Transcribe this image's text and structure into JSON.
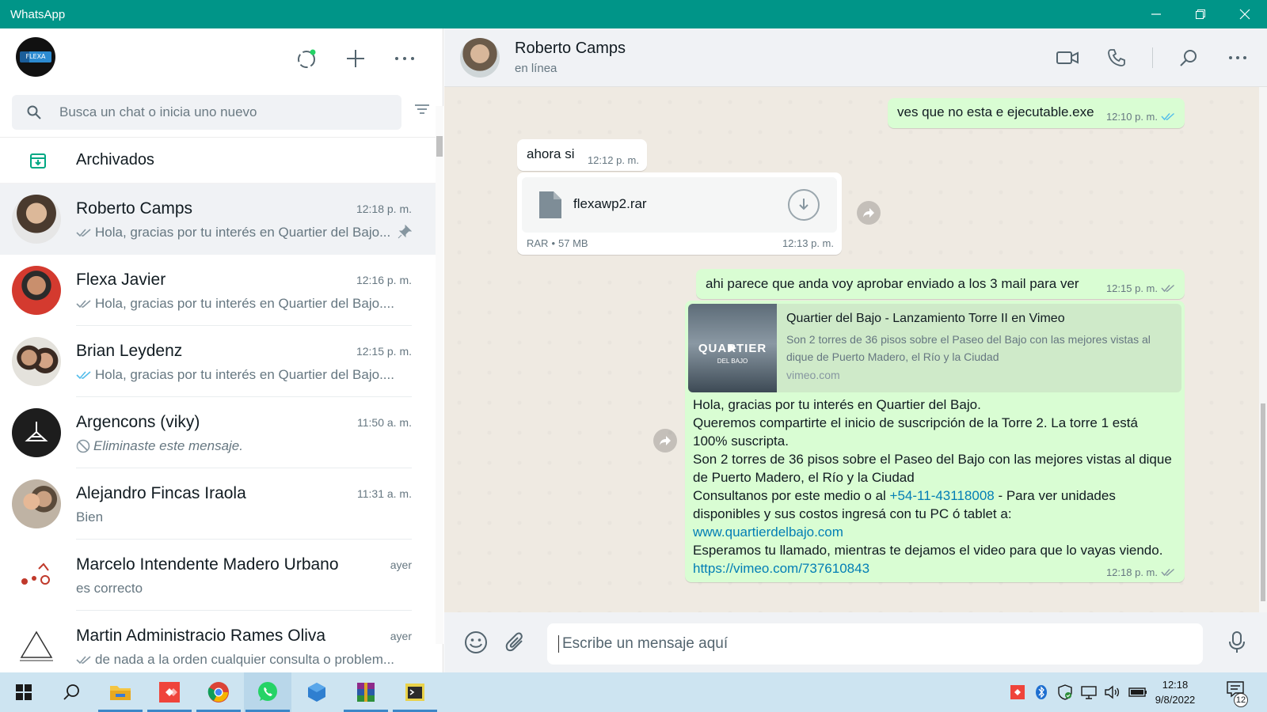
{
  "window": {
    "title": "WhatsApp"
  },
  "sidebar": {
    "search_placeholder": "Busca un chat o inicia uno nuevo",
    "archived_label": "Archivados",
    "chats": [
      {
        "name": "Roberto Camps",
        "time": "12:18 p. m.",
        "preview": "Hola, gracias por tu interés en Quartier del Bajo...",
        "ticks": "read",
        "pinned": true,
        "selected": true,
        "avatar_color": "#b89a82"
      },
      {
        "name": "Flexa Javier",
        "time": "12:16 p. m.",
        "preview": "Hola, gracias por tu interés en Quartier del Bajo....",
        "ticks": "delivered",
        "avatar_color": "#c0392b"
      },
      {
        "name": "Brian Leydenz",
        "time": "12:15 p. m.",
        "preview": "Hola, gracias por tu interés en Quartier del Bajo....",
        "ticks": "read",
        "avatar_color": "#8d7a6b"
      },
      {
        "name": "Argencons (viky)",
        "time": "11:50 a. m.",
        "preview": "Eliminaste este mensaje.",
        "ticks": "deleted",
        "avatar_color": "#1d1d1d"
      },
      {
        "name": "Alejandro Fincas Iraola",
        "time": "11:31 a. m.",
        "preview": "Bien",
        "ticks": "none",
        "avatar_color": "#9b8c77"
      },
      {
        "name": "Marcelo Intendente Madero Urbano",
        "time": "ayer",
        "preview": "es correcto",
        "ticks": "none",
        "avatar_color": "#ffffff"
      },
      {
        "name": "Martin Administracio Rames Oliva",
        "time": "ayer",
        "preview": "de nada a la orden cualquier consulta o problem...",
        "ticks": "delivered",
        "avatar_color": "#ffffff"
      }
    ]
  },
  "conversation": {
    "contact_name": "Roberto Camps",
    "contact_status": "en línea",
    "messages": {
      "m1": {
        "text": "ves que no esta e ejecutable.exe",
        "time": "12:10 p. m."
      },
      "m2": {
        "text": "ahora si",
        "time": "12:12 p. m."
      },
      "file": {
        "name": "flexawp2.rar",
        "type": "RAR",
        "size": "57 MB",
        "time": "12:13 p. m."
      },
      "m3": {
        "text": "ahi parece que anda voy aprobar enviado a los 3 mail para ver",
        "time": "12:15 p. m."
      },
      "m4": {
        "preview_title": "Quartier del Bajo - Lanzamiento Torre II en Vimeo",
        "preview_desc": "Son 2 torres de 36 pisos sobre el Paseo del Bajo con las mejores vistas al dique de Puerto Madero, el Río y la Ciudad",
        "preview_domain": "vimeo.com",
        "thumb_text": "QUARTIER",
        "thumb_sub": "DEL BAJO",
        "line1": "Hola, gracias por tu interés en Quartier del Bajo.",
        "line2": "Queremos compartirte el inicio de suscripción de la Torre 2. La torre 1 está 100% suscripta.",
        "line3": "Son 2 torres de 36 pisos sobre el Paseo del Bajo con las mejores vistas al dique de Puerto Madero, el Río y la Ciudad",
        "line4a": "Consultanos por este medio o al ",
        "phone": "+54-11-43118008",
        "line4b": " - Para ver unidades disponibles y sus costos ingresá con tu PC ó tablet a:",
        "website": "www.quartierdelbajo.com",
        "line5": "Esperamos tu llamado, mientras te dejamos el video para que lo vayas viendo. ",
        "video_link": "https://vimeo.com/737610843",
        "time": "12:18 p. m."
      }
    },
    "composer_placeholder": "Escribe un mensaje aquí"
  },
  "taskbar": {
    "clock_time": "12:18",
    "clock_date": "9/8/2022",
    "notification_count": "12"
  },
  "colors": {
    "titlebar": "#009588",
    "outgoing_bubble": "#d9fdd3",
    "read_tick": "#53bdeb",
    "link": "#027eb5"
  }
}
